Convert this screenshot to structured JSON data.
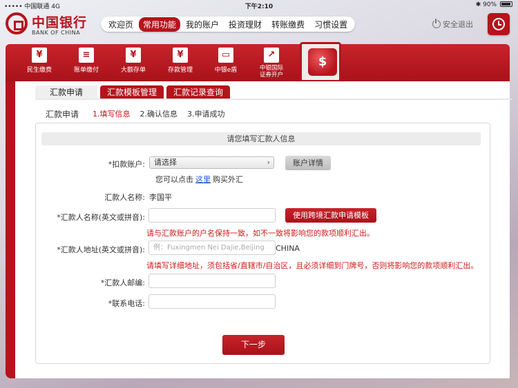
{
  "status_bar": {
    "carrier": "••••• 中国联通  4G",
    "time": "下午2:10",
    "battery": "90%"
  },
  "header": {
    "logo_cn": "中国银行",
    "logo_en": "BANK OF CHINA",
    "nav": [
      "欢迎页",
      "常用功能",
      "我的账户",
      "投资理财",
      "转账缴费",
      "习惯设置"
    ],
    "active_nav": "常用功能",
    "logout": "安全退出"
  },
  "toolbar": {
    "items": [
      {
        "label": "民生缴费",
        "icon": "house-yen-icon"
      },
      {
        "label": "账单缴付",
        "icon": "bill-icon"
      },
      {
        "label": "大额存单",
        "icon": "certificate-icon"
      },
      {
        "label": "存款管理",
        "icon": "deposit-icon"
      },
      {
        "label": "中银e盾",
        "icon": "usb-key-icon"
      },
      {
        "label": "中银国际证券开户",
        "icon": "chart-up-icon"
      }
    ],
    "active_icon": "globe-currency-icon"
  },
  "tabs": [
    "汇款申请",
    "汇款模板管理",
    "汇款记录查询"
  ],
  "steps": {
    "title": "汇款申请",
    "items": [
      "1.填写信息",
      "2.确认信息",
      "3.申请成功"
    ]
  },
  "form": {
    "heading": "请您填写汇款人信息",
    "debit_account_label": "*扣款账户:",
    "debit_account_value": "请选择",
    "account_detail_button": "账户详情",
    "hint_prefix": "您可以点击",
    "hint_link": "这里",
    "hint_suffix": "购买外汇",
    "remitter_name_label": "汇款人名称:",
    "remitter_name_value": "李国平",
    "remitter_name_en_label": "*汇款人名称(英文或拼音):",
    "template_button": "使用跨境汇款申请模板",
    "name_warning": "请与汇款账户的户名保持一致，如不一致将影响您的款项顺利汇出。",
    "address_label": "*汇款人地址(英文或拼音):",
    "address_placeholder": "例：Fuxingmen Nei Dajie,Beijing",
    "address_country": "CHINA",
    "address_warning": "请填写详细地址，须包括省/直辖市/自治区，且必须详细到门牌号，否则将影响您的款项顺利汇出。",
    "zip_label": "*汇款人邮编:",
    "phone_label": "*联系电话:",
    "next_button": "下一步"
  }
}
